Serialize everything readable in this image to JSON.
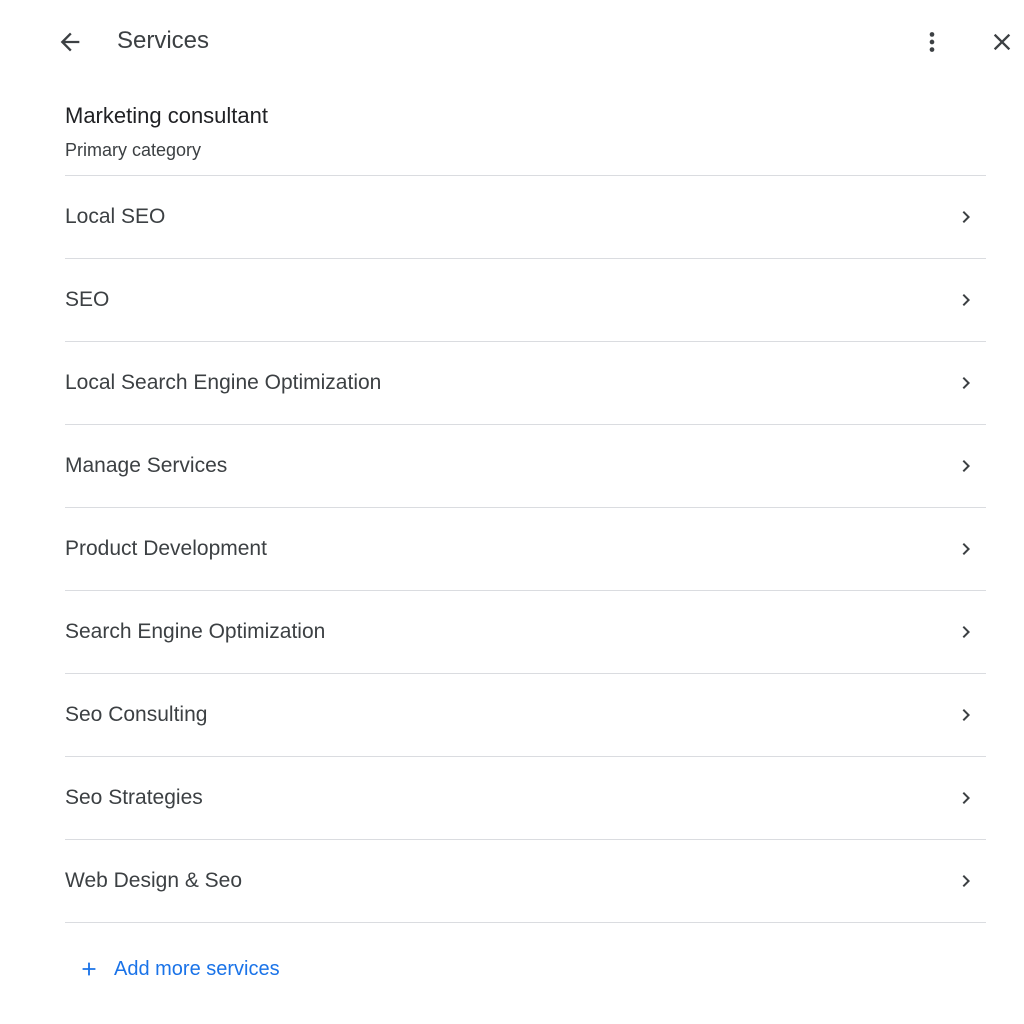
{
  "header": {
    "title": "Services",
    "back_icon": "arrow-back-icon",
    "more_icon": "more-vert-icon",
    "close_icon": "close-icon"
  },
  "category": {
    "name": "Marketing consultant",
    "subtitle": "Primary category"
  },
  "services": [
    {
      "label": "Local SEO"
    },
    {
      "label": "SEO"
    },
    {
      "label": "Local Search Engine Optimization"
    },
    {
      "label": "Manage Services"
    },
    {
      "label": "Product Development"
    },
    {
      "label": "Search Engine Optimization"
    },
    {
      "label": "Seo Consulting"
    },
    {
      "label": "Seo Strategies"
    },
    {
      "label": "Web Design & Seo"
    }
  ],
  "add_more": {
    "label": "Add more services",
    "icon": "plus-icon"
  },
  "colors": {
    "text": "#3c4043",
    "heading": "#202124",
    "divider": "#dadce0",
    "accent": "#1a73e8",
    "icon": "#5f6368"
  }
}
